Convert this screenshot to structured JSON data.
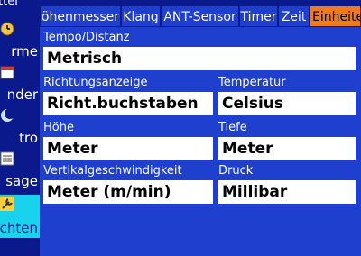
{
  "sidebar": {
    "top_label": "tter",
    "items": [
      {
        "label": "rme",
        "icon": "clock-icon"
      },
      {
        "label": "nder",
        "icon": "calendar-icon"
      },
      {
        "label": "tro",
        "icon": "moon-icon"
      },
      {
        "label": "sage",
        "icon": "list-icon"
      },
      {
        "label": "chten",
        "icon": "wrench-icon"
      }
    ]
  },
  "tabs": [
    {
      "label": "öhenmesser"
    },
    {
      "label": "Klang"
    },
    {
      "label": "ANT-Sensor"
    },
    {
      "label": "Timer"
    },
    {
      "label": "Zeit"
    },
    {
      "label": "Einheiten"
    }
  ],
  "fields": {
    "distance": {
      "label": "Tempo/Distanz",
      "value": "Metrisch"
    },
    "heading": {
      "label": "Richtungsanzeige",
      "value": "Richt.buchstaben"
    },
    "temperature": {
      "label": "Temperatur",
      "value": "Celsius"
    },
    "elevation": {
      "label": "Höhe",
      "value": "Meter"
    },
    "depth": {
      "label": "Tiefe",
      "value": "Meter"
    },
    "vertical_speed": {
      "label": "Vertikalgeschwindigkeit",
      "value": "Meter (m/min)"
    },
    "pressure": {
      "label": "Druck",
      "value": "Millibar"
    }
  },
  "colors": {
    "background": "#0a1a8c",
    "tab": "#1f3fcf",
    "active_tab": "#ee7a1a",
    "active_sidebar": "#19d3ec",
    "field": "#ffffff"
  }
}
